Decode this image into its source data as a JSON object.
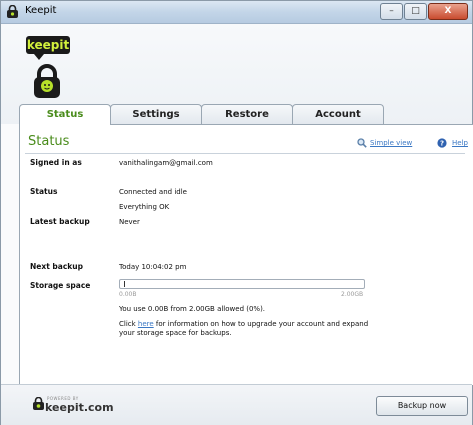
{
  "window": {
    "title": "Keepit",
    "controls": [
      "–",
      "□",
      "X"
    ]
  },
  "header": {
    "logo_text": "keepit"
  },
  "tabs": [
    {
      "label": "Status",
      "active": true
    },
    {
      "label": "Settings",
      "active": false
    },
    {
      "label": "Restore",
      "active": false
    },
    {
      "label": "Account",
      "active": false
    }
  ],
  "page": {
    "title": "Status",
    "simple_view_label": "Simple view",
    "help_label": "Help"
  },
  "fields": {
    "signed_in_label": "Signed in as",
    "signed_in_value": "vanithalingam@gmail.com",
    "status_label": "Status",
    "status_line1": "Connected and idle",
    "status_line2": "Everything OK",
    "latest_backup_label": "Latest backup",
    "latest_backup_value": "Never",
    "next_backup_label": "Next backup",
    "next_backup_value": "Today 10:04:02 pm",
    "storage_label": "Storage space",
    "storage_min": "0.00B",
    "storage_max": "2.00GB",
    "storage_fraction": 0.0,
    "storage_usage_text": "You use 0.00B from 2.00GB allowed (0%).",
    "upgrade_prefix": "Click ",
    "upgrade_link": "here",
    "upgrade_suffix": " for information on how to upgrade your account and expand your storage space for backups."
  },
  "footer": {
    "powered_by": "POWERED BY",
    "brand": "keepit.com",
    "backup_button": "Backup now"
  },
  "colors": {
    "accent_green": "#4a8c1c",
    "link_blue": "#3b78c4"
  }
}
